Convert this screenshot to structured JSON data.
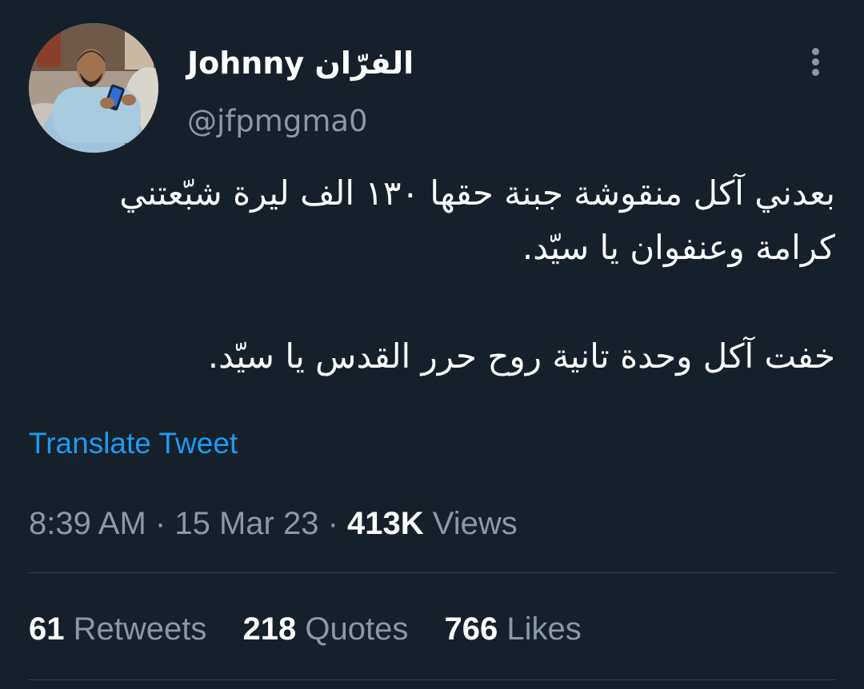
{
  "tweet": {
    "author": {
      "display_name": "Johnny الفرّان",
      "handle": "@jfpmgma0",
      "avatar_icon": "profile-photo"
    },
    "more_icon": "three-dots-vertical-icon",
    "text_lines": [
      "بعدني آكل منقوشة جبنة حقها ١٣٠ الف ليرة شبّعتني",
      "كرامة وعنفوان يا سيّد.",
      "خفت آكل وحدة تانية روح حرر القدس يا سيّد."
    ],
    "translate_label": "Translate Tweet",
    "time": "8:39 AM",
    "separator": "·",
    "date": "15 Mar 23",
    "views_count": "413K",
    "views_label": "Views",
    "stats": {
      "retweets_count": "61",
      "retweets_label": "Retweets",
      "quotes_count": "218",
      "quotes_label": "Quotes",
      "likes_count": "766",
      "likes_label": "Likes"
    }
  },
  "colors": {
    "background": "#15202b",
    "text_primary": "#ffffff",
    "text_secondary": "#8b98a5",
    "link": "#1d9bf0",
    "divider": "#38444d"
  }
}
